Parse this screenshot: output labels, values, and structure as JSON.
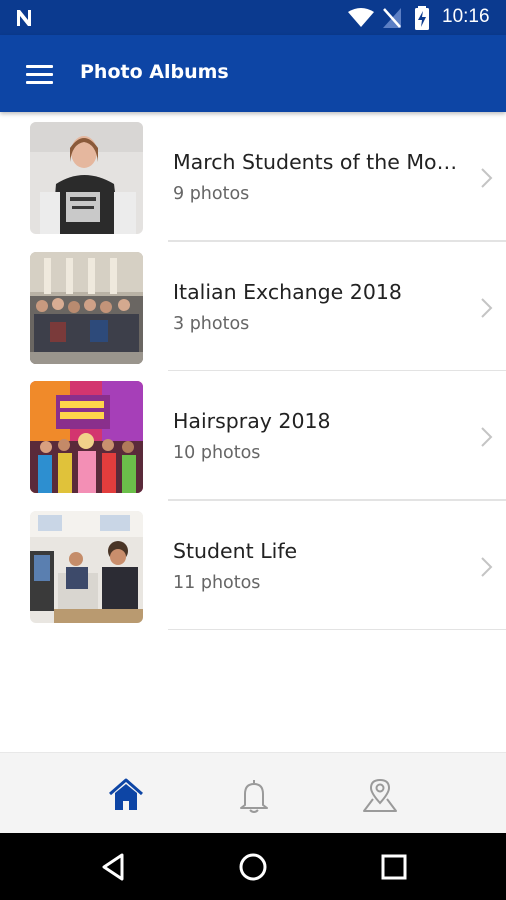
{
  "status_bar": {
    "time": "10:16"
  },
  "header": {
    "title": "Photo Albums"
  },
  "albums": [
    {
      "title": "March Students of the Mo…",
      "count": "9 photos"
    },
    {
      "title": "Italian Exchange 2018",
      "count": "3 photos"
    },
    {
      "title": "Hairspray 2018",
      "count": "10 photos"
    },
    {
      "title": "Student Life",
      "count": "11 photos"
    }
  ],
  "bottom_nav": {
    "items": [
      {
        "icon": "home-icon",
        "active": true
      },
      {
        "icon": "bell-icon",
        "active": false
      },
      {
        "icon": "map-pin-icon",
        "active": false
      }
    ]
  },
  "colors": {
    "app_bar": "#0d45a5",
    "status_bar": "#0b3a8f",
    "active_nav": "#0d45a5",
    "inactive_nav": "#9a9a9a"
  }
}
